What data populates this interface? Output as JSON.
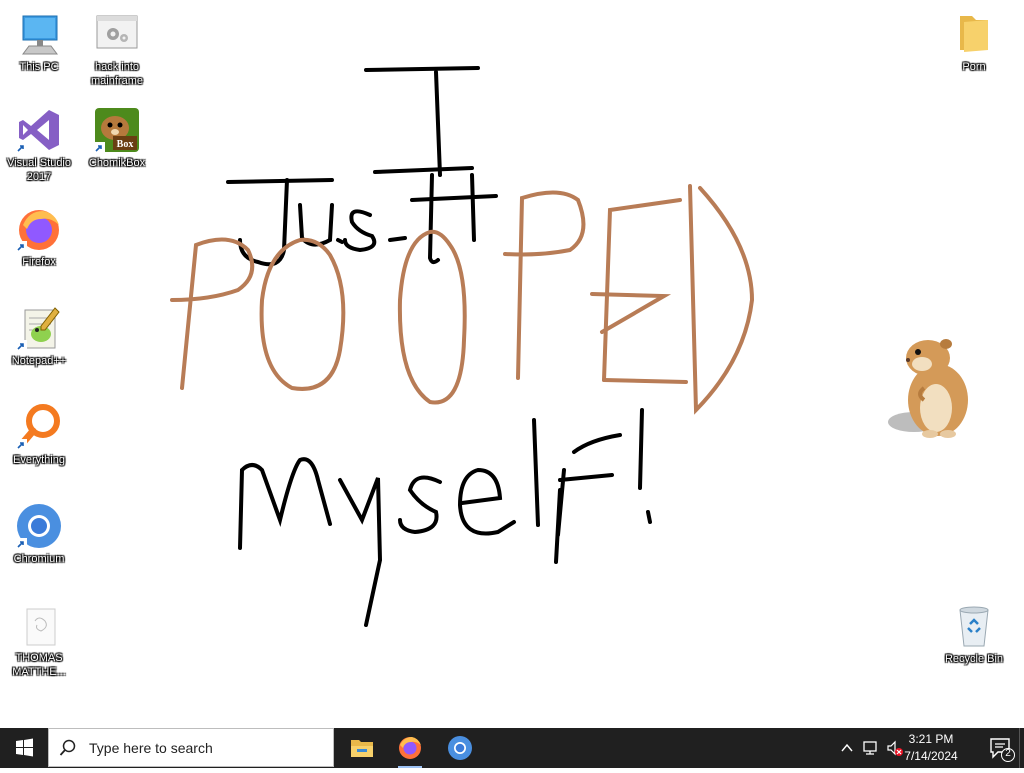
{
  "desktop": {
    "wallpaper": {
      "line1": "I",
      "line2": "Just",
      "line3": "POOPED",
      "line4": "Myself!",
      "ink_black": "#000000",
      "ink_brown": "#b87c56"
    },
    "left_icons": [
      {
        "label": "This PC",
        "icon": "this-pc-icon"
      },
      {
        "label": "Visual Studio 2017",
        "icon": "visual-studio-icon"
      },
      {
        "label": "Firefox",
        "icon": "firefox-icon"
      },
      {
        "label": "Notepad++",
        "icon": "notepad-plus-plus-icon"
      },
      {
        "label": "Everything",
        "icon": "everything-icon"
      },
      {
        "label": "Chromium",
        "icon": "chromium-icon"
      },
      {
        "label": "THOMAS MATTHE...",
        "icon": "document-icon"
      }
    ],
    "second_column_icons": [
      {
        "label": "hack into mainframe",
        "icon": "settings-window-icon"
      },
      {
        "label": "ChomikBox",
        "icon": "chomikbox-icon"
      }
    ],
    "right_icons": [
      {
        "label": "Porn",
        "icon": "folder-icon"
      },
      {
        "label": "Recycle Bin",
        "icon": "recycle-bin-icon"
      }
    ],
    "mascot": "hamster-icon"
  },
  "taskbar": {
    "search_placeholder": "Type here to search",
    "apps": [
      "file-explorer-icon",
      "firefox-icon",
      "chromium-icon"
    ],
    "clock_time": "3:21 PM",
    "clock_date": "7/14/2024",
    "notification_count": "2",
    "bg_color": "#202020",
    "accent": "#9ec3f5"
  }
}
